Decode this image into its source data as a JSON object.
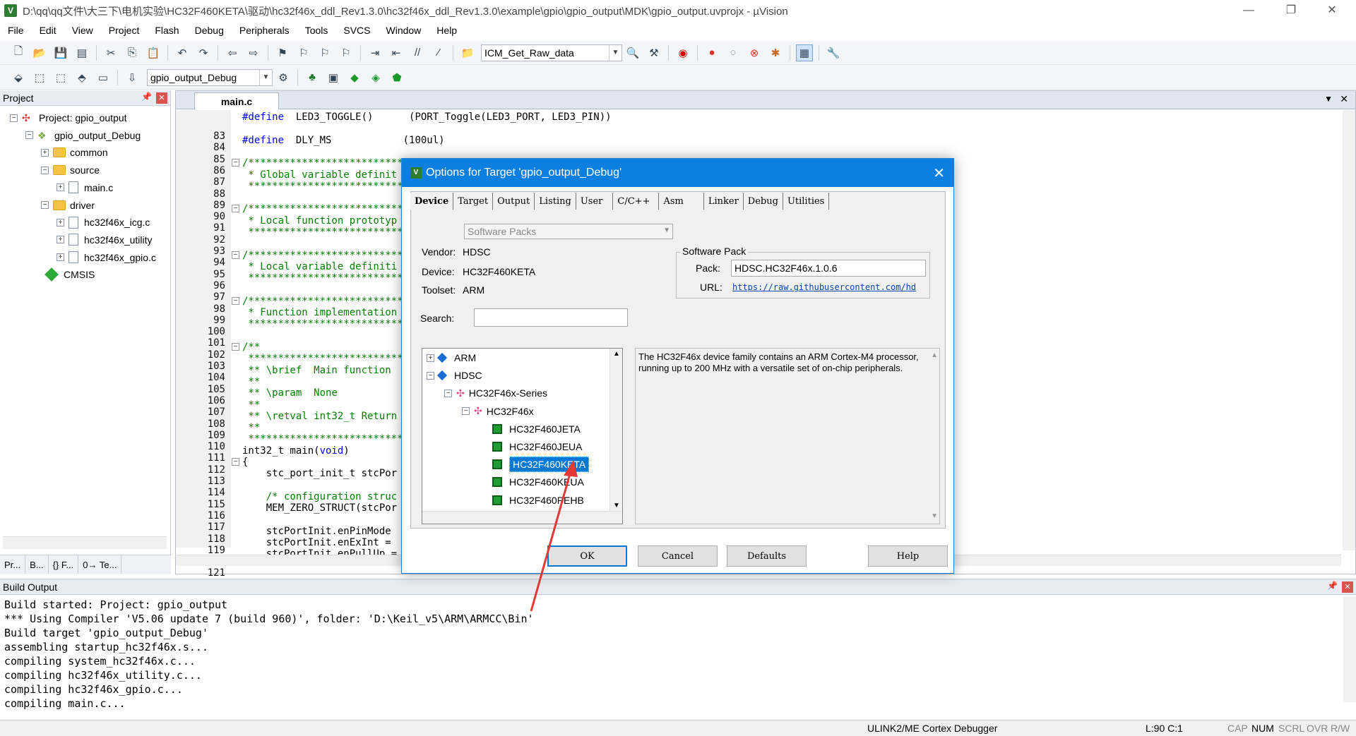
{
  "window": {
    "title": "D:\\qq\\qq文件\\大三下\\电机实验\\HC32F460KETA\\驱动\\hc32f46x_ddl_Rev1.3.0\\hc32f46x_ddl_Rev1.3.0\\example\\gpio\\gpio_output\\MDK\\gpio_output.uvprojx - µVision",
    "minimize": "—",
    "restore": "❐",
    "close": "✕"
  },
  "menu": [
    "File",
    "Edit",
    "View",
    "Project",
    "Flash",
    "Debug",
    "Peripherals",
    "Tools",
    "SVCS",
    "Window",
    "Help"
  ],
  "toolbar": {
    "find_combo_value": "ICM_Get_Raw_data",
    "target_combo_value": "gpio_output_Debug"
  },
  "project_panel": {
    "header": "Project",
    "tree": [
      {
        "label": "Project: gpio_output",
        "depth": 0,
        "kind": "project",
        "exp": "−"
      },
      {
        "label": "gpio_output_Debug",
        "depth": 1,
        "kind": "target",
        "exp": "−"
      },
      {
        "label": "common",
        "depth": 2,
        "kind": "folder",
        "exp": "+"
      },
      {
        "label": "source",
        "depth": 2,
        "kind": "folder",
        "exp": "−"
      },
      {
        "label": "main.c",
        "depth": 3,
        "kind": "file",
        "exp": "+"
      },
      {
        "label": "driver",
        "depth": 2,
        "kind": "folder",
        "exp": "−"
      },
      {
        "label": "hc32f46x_icg.c",
        "depth": 3,
        "kind": "file",
        "exp": "+"
      },
      {
        "label": "hc32f46x_utility",
        "depth": 3,
        "kind": "file",
        "exp": "+"
      },
      {
        "label": "hc32f46x_gpio.c",
        "depth": 3,
        "kind": "file",
        "exp": "+"
      },
      {
        "label": "CMSIS",
        "depth": 2,
        "kind": "gem",
        "exp": ""
      }
    ],
    "bottom_tabs": [
      "Pr...",
      "B...",
      "{} F...",
      "0→ Te..."
    ]
  },
  "editor": {
    "tab": "main.c",
    "lines": [
      {
        "n": "83",
        "t": "#define  LED3_TOGGLE()      (PORT_Toggle(LED3_PORT, LED3_PIN))",
        "c": "pp"
      },
      {
        "n": "84",
        "t": "",
        "c": ""
      },
      {
        "n": "85",
        "t": "#define  DLY_MS            (100ul)",
        "c": "pp"
      },
      {
        "n": "86",
        "t": "",
        "c": ""
      },
      {
        "n": "87",
        "t": "/*****************************",
        "c": "cm",
        "fold": "−"
      },
      {
        "n": "88",
        "t": " * Global variable definit",
        "c": "cm"
      },
      {
        "n": "89",
        "t": " *****************************",
        "c": "cm"
      },
      {
        "n": "90",
        "t": "",
        "c": ""
      },
      {
        "n": "91",
        "t": "/*****************************",
        "c": "cm",
        "fold": "−"
      },
      {
        "n": "92",
        "t": " * Local function prototyp",
        "c": "cm"
      },
      {
        "n": "93",
        "t": " *****************************",
        "c": "cm"
      },
      {
        "n": "94",
        "t": "",
        "c": ""
      },
      {
        "n": "95",
        "t": "/*****************************",
        "c": "cm",
        "fold": "−"
      },
      {
        "n": "96",
        "t": " * Local variable definiti",
        "c": "cm"
      },
      {
        "n": "97",
        "t": " *****************************",
        "c": "cm"
      },
      {
        "n": "98",
        "t": "",
        "c": ""
      },
      {
        "n": "99",
        "t": "/*****************************",
        "c": "cm",
        "fold": "−"
      },
      {
        "n": "100",
        "t": " * Function implementation",
        "c": "cm"
      },
      {
        "n": "101",
        "t": " *****************************",
        "c": "cm"
      },
      {
        "n": "102",
        "t": "",
        "c": ""
      },
      {
        "n": "103",
        "t": "/**",
        "c": "cm",
        "fold": "−"
      },
      {
        "n": "104",
        "t": " *****************************",
        "c": "cm"
      },
      {
        "n": "105",
        "t": " ** \\brief  Main function ",
        "c": "cm"
      },
      {
        "n": "106",
        "t": " **",
        "c": "cm"
      },
      {
        "n": "107",
        "t": " ** \\param  None",
        "c": "cm"
      },
      {
        "n": "108",
        "t": " **",
        "c": "cm"
      },
      {
        "n": "109",
        "t": " ** \\retval int32_t Return",
        "c": "cm"
      },
      {
        "n": "110",
        "t": " **",
        "c": "cm"
      },
      {
        "n": "111",
        "t": " *****************************",
        "c": "cm"
      },
      {
        "n": "112",
        "t": "int32_t main(void)",
        "c": "fn"
      },
      {
        "n": "113",
        "t": "{",
        "c": "",
        "fold": "−"
      },
      {
        "n": "114",
        "t": "    stc_port_init_t stcPor",
        "c": ""
      },
      {
        "n": "115",
        "t": "",
        "c": ""
      },
      {
        "n": "116",
        "t": "    /* configuration struc",
        "c": "cm"
      },
      {
        "n": "117",
        "t": "    MEM_ZERO_STRUCT(stcPor",
        "c": ""
      },
      {
        "n": "118",
        "t": "",
        "c": ""
      },
      {
        "n": "119",
        "t": "    stcPortInit.enPinMode ",
        "c": ""
      },
      {
        "n": "120",
        "t": "    stcPortInit.enExInt = ",
        "c": ""
      },
      {
        "n": "121",
        "t": "    stcPortInit.enPullUp =",
        "c": ""
      }
    ]
  },
  "build_output": {
    "header": "Build Output",
    "lines": [
      "Build started: Project: gpio_output",
      "*** Using Compiler 'V5.06 update 7 (build 960)', folder: 'D:\\Keil_v5\\ARM\\ARMCC\\Bin'",
      "Build target 'gpio_output_Debug'",
      "assembling startup_hc32f46x.s...",
      "compiling system_hc32f46x.c...",
      "compiling hc32f46x_utility.c...",
      "compiling hc32f46x_gpio.c...",
      "compiling main.c..."
    ]
  },
  "status": {
    "debugger": "ULINK2/ME Cortex Debugger",
    "position": "L:90 C:1",
    "indicators": [
      "CAP",
      "NUM",
      "SCRL",
      "OVR",
      "R/W"
    ]
  },
  "dialog": {
    "title": "Options for Target 'gpio_output_Debug'",
    "tabs": [
      "Device",
      "Target",
      "Output",
      "Listing",
      "User",
      "C/C++",
      "Asm",
      "Linker",
      "Debug",
      "Utilities"
    ],
    "active_tab": "Device",
    "software_packs_combo": "Software Packs",
    "vendor_label": "Vendor:",
    "vendor": "HDSC",
    "device_label": "Device:",
    "device": "HC32F460KETA",
    "toolset_label": "Toolset:",
    "toolset": "ARM",
    "search_label": "Search:",
    "search_value": "",
    "software_pack_group": "Software Pack",
    "pack_label": "Pack:",
    "pack": "HDSC.HC32F46x.1.0.6",
    "url_label": "URL:",
    "url": "https://raw.githubusercontent.com/hd",
    "device_tree": [
      {
        "label": "ARM",
        "depth": 0,
        "kind": "vendor",
        "exp": "+"
      },
      {
        "label": "HDSC",
        "depth": 0,
        "kind": "vendor",
        "exp": "−"
      },
      {
        "label": "HC32F46x-Series",
        "depth": 1,
        "kind": "series",
        "exp": "−"
      },
      {
        "label": "HC32F46x",
        "depth": 2,
        "kind": "series",
        "exp": "−"
      },
      {
        "label": "HC32F460JETA",
        "depth": 3,
        "kind": "chip",
        "exp": ""
      },
      {
        "label": "HC32F460JEUA",
        "depth": 3,
        "kind": "chip",
        "exp": ""
      },
      {
        "label": "HC32F460KETA",
        "depth": 3,
        "kind": "chip",
        "exp": "",
        "selected": true
      },
      {
        "label": "HC32F460KEUA",
        "depth": 3,
        "kind": "chip",
        "exp": ""
      },
      {
        "label": "HC32F460PEHB",
        "depth": 3,
        "kind": "chip",
        "exp": ""
      }
    ],
    "description": "The HC32F46x device family contains an ARM Cortex-M4 processor, running up to 200 MHz with a versatile set of on-chip peripherals.",
    "buttons": {
      "ok": "OK",
      "cancel": "Cancel",
      "defaults": "Defaults",
      "help": "Help"
    }
  },
  "colors": {
    "dialog_title_bg": "#0d7fe0",
    "selection_bg": "#0078d7",
    "annotation_arrow": "#e53935"
  }
}
